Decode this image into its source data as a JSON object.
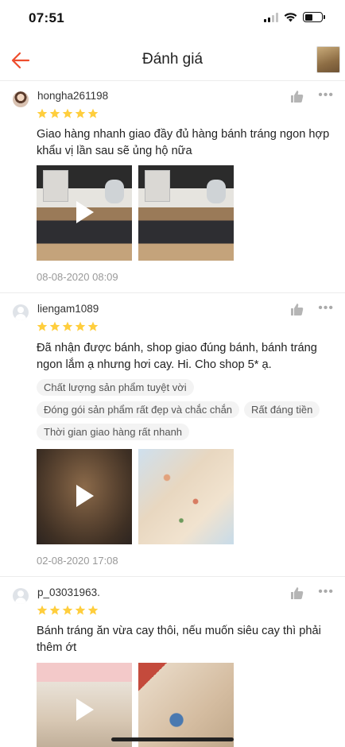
{
  "status_bar": {
    "time": "07:51"
  },
  "header": {
    "title": "Đánh giá"
  },
  "colors": {
    "accent": "#ee4d2d",
    "star": "#ffce3d"
  },
  "reviews": [
    {
      "username": "hongha261198",
      "rating": 5,
      "comment": "Giao hàng nhanh giao đầy đủ hàng bánh tráng ngon hợp khẩu vị lần sau sẽ ủng hộ nữa",
      "tags": [],
      "media": [
        "video",
        "image"
      ],
      "date": "08-08-2020 08:09"
    },
    {
      "username": "liengam1089",
      "rating": 5,
      "comment": "Đã nhận được bánh, shop giao đúng bánh, bánh tráng ngon lắm ạ nhưng hơi cay. Hi. Cho shop 5* ạ.",
      "tags": [
        "Chất lượng sản phẩm tuyệt vời",
        "Đóng gói sản phẩm rất đẹp và chắc chắn",
        "Rất đáng tiền",
        "Thời gian giao hàng rất nhanh"
      ],
      "media": [
        "video",
        "image"
      ],
      "date": "02-08-2020 17:08"
    },
    {
      "username": "p_03031963.",
      "rating": 5,
      "comment": "Bánh tráng ăn vừa cay thôi, nếu muốn siêu cay thì phải thêm ớt",
      "tags": [],
      "media": [
        "video",
        "image"
      ],
      "date": ""
    }
  ]
}
